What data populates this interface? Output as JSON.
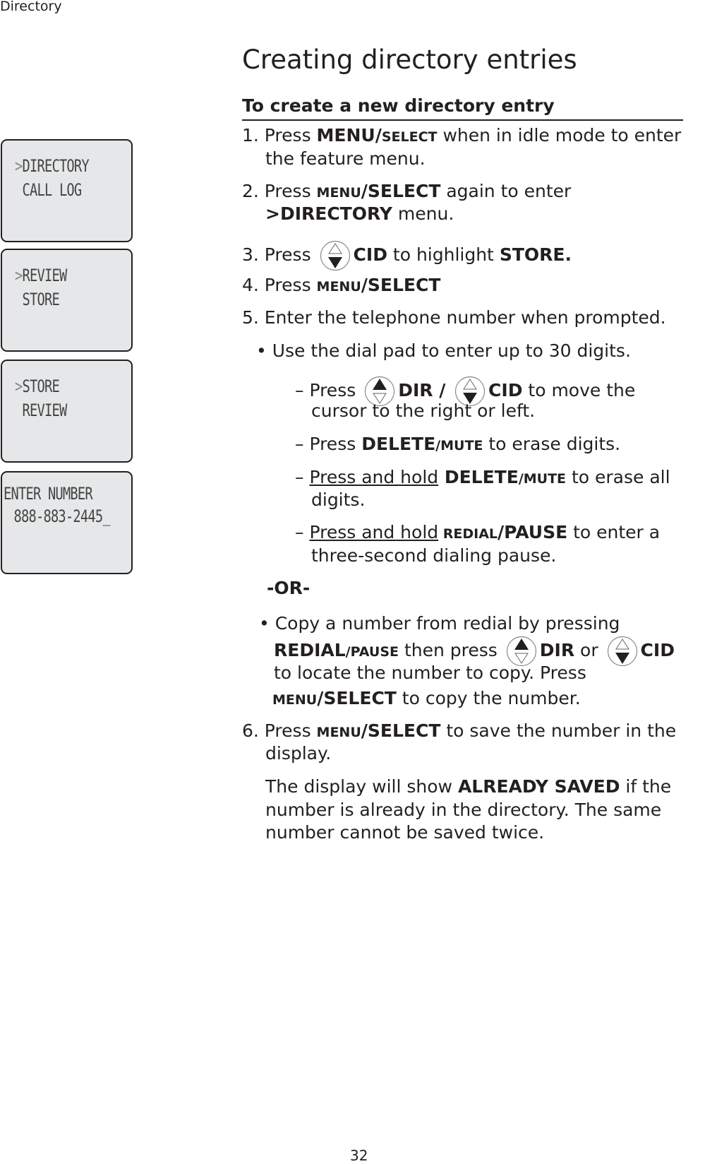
{
  "header": {
    "section": "Directory"
  },
  "page_number": "32",
  "title": "Creating directory entries",
  "subtitle": "To create a new directory entry",
  "lcd_screens": [
    {
      "line1_arrow": ">",
      "line1": "DIRECTORY",
      "line2": " CALL LOG"
    },
    {
      "line1_arrow": ">",
      "line1": "REVIEW",
      "line2": " STORE"
    },
    {
      "line1_arrow": ">",
      "line1": "STORE",
      "line2": " REVIEW"
    },
    {
      "line1_arrow": "",
      "line1": "ENTER NUMBER",
      "line2": " 888-883-2445_"
    }
  ],
  "steps": {
    "s1a": "1. Press ",
    "s1b": "MENU/",
    "s1c": "SELECT",
    "s1d": " when in idle mode to enter",
    "s1e": "the feature menu.",
    "s2a": "2. Press ",
    "s2b": "MENU",
    "s2c": "/SELECT",
    "s2d": " again to enter",
    "s2e": ">DIRECTORY",
    "s2f": " menu.",
    "s3a": "3. Press ",
    "s3b": "CID",
    "s3c": " to highlight ",
    "s3d": "STORE.",
    "s4a": "4. Press ",
    "s4b": "MENU",
    "s4c": "/SELECT",
    "s5": "5. Enter the telephone number when prompted.",
    "b1": "• Use the dial pad to enter up to 30 digits.",
    "d1a": "–  Press ",
    "d1b": "DIR / ",
    "d1c": "CID",
    "d1d": " to move the",
    "d1e": "cursor to the right or left.",
    "d2a": "–  Press ",
    "d2b": "DELETE",
    "d2c": "/MUTE",
    "d2d": " to erase digits.",
    "d3a": "–  ",
    "d3b": "Press and hold",
    "d3c": " DELETE",
    "d3d": "/MUTE",
    "d3e": " to erase all",
    "d3f": "digits.",
    "d4a": "–  ",
    "d4b": "Press and hold",
    "d4c": " REDIAL",
    "d4d": "/PAUSE",
    "d4e": " to enter a",
    "d4f": "three-second dialing pause.",
    "or": "-OR-",
    "b2a": "• Copy a number from redial by pressing",
    "b2b": "REDIAL",
    "b2c": "/PAUSE",
    "b2d": " then press ",
    "b2e": "DIR",
    "b2f": " or ",
    "b2g": "CID",
    "b2h": "to locate the number to copy. Press",
    "b2i": "MENU",
    "b2j": "/SELECT",
    "b2k": " to copy the number.",
    "s6a": "6. Press ",
    "s6b": "MENU",
    "s6c": "/SELECT",
    "s6d": " to save the number in the",
    "s6e": "display.",
    "n1a": "The display will show ",
    "n1b": "ALREADY SAVED",
    "n1c": " if the",
    "n2": "number is already in the directory. The same",
    "n3": "number cannot be saved twice."
  },
  "icons": {
    "up": "dir-up-button-icon",
    "down": "cid-down-button-icon"
  }
}
